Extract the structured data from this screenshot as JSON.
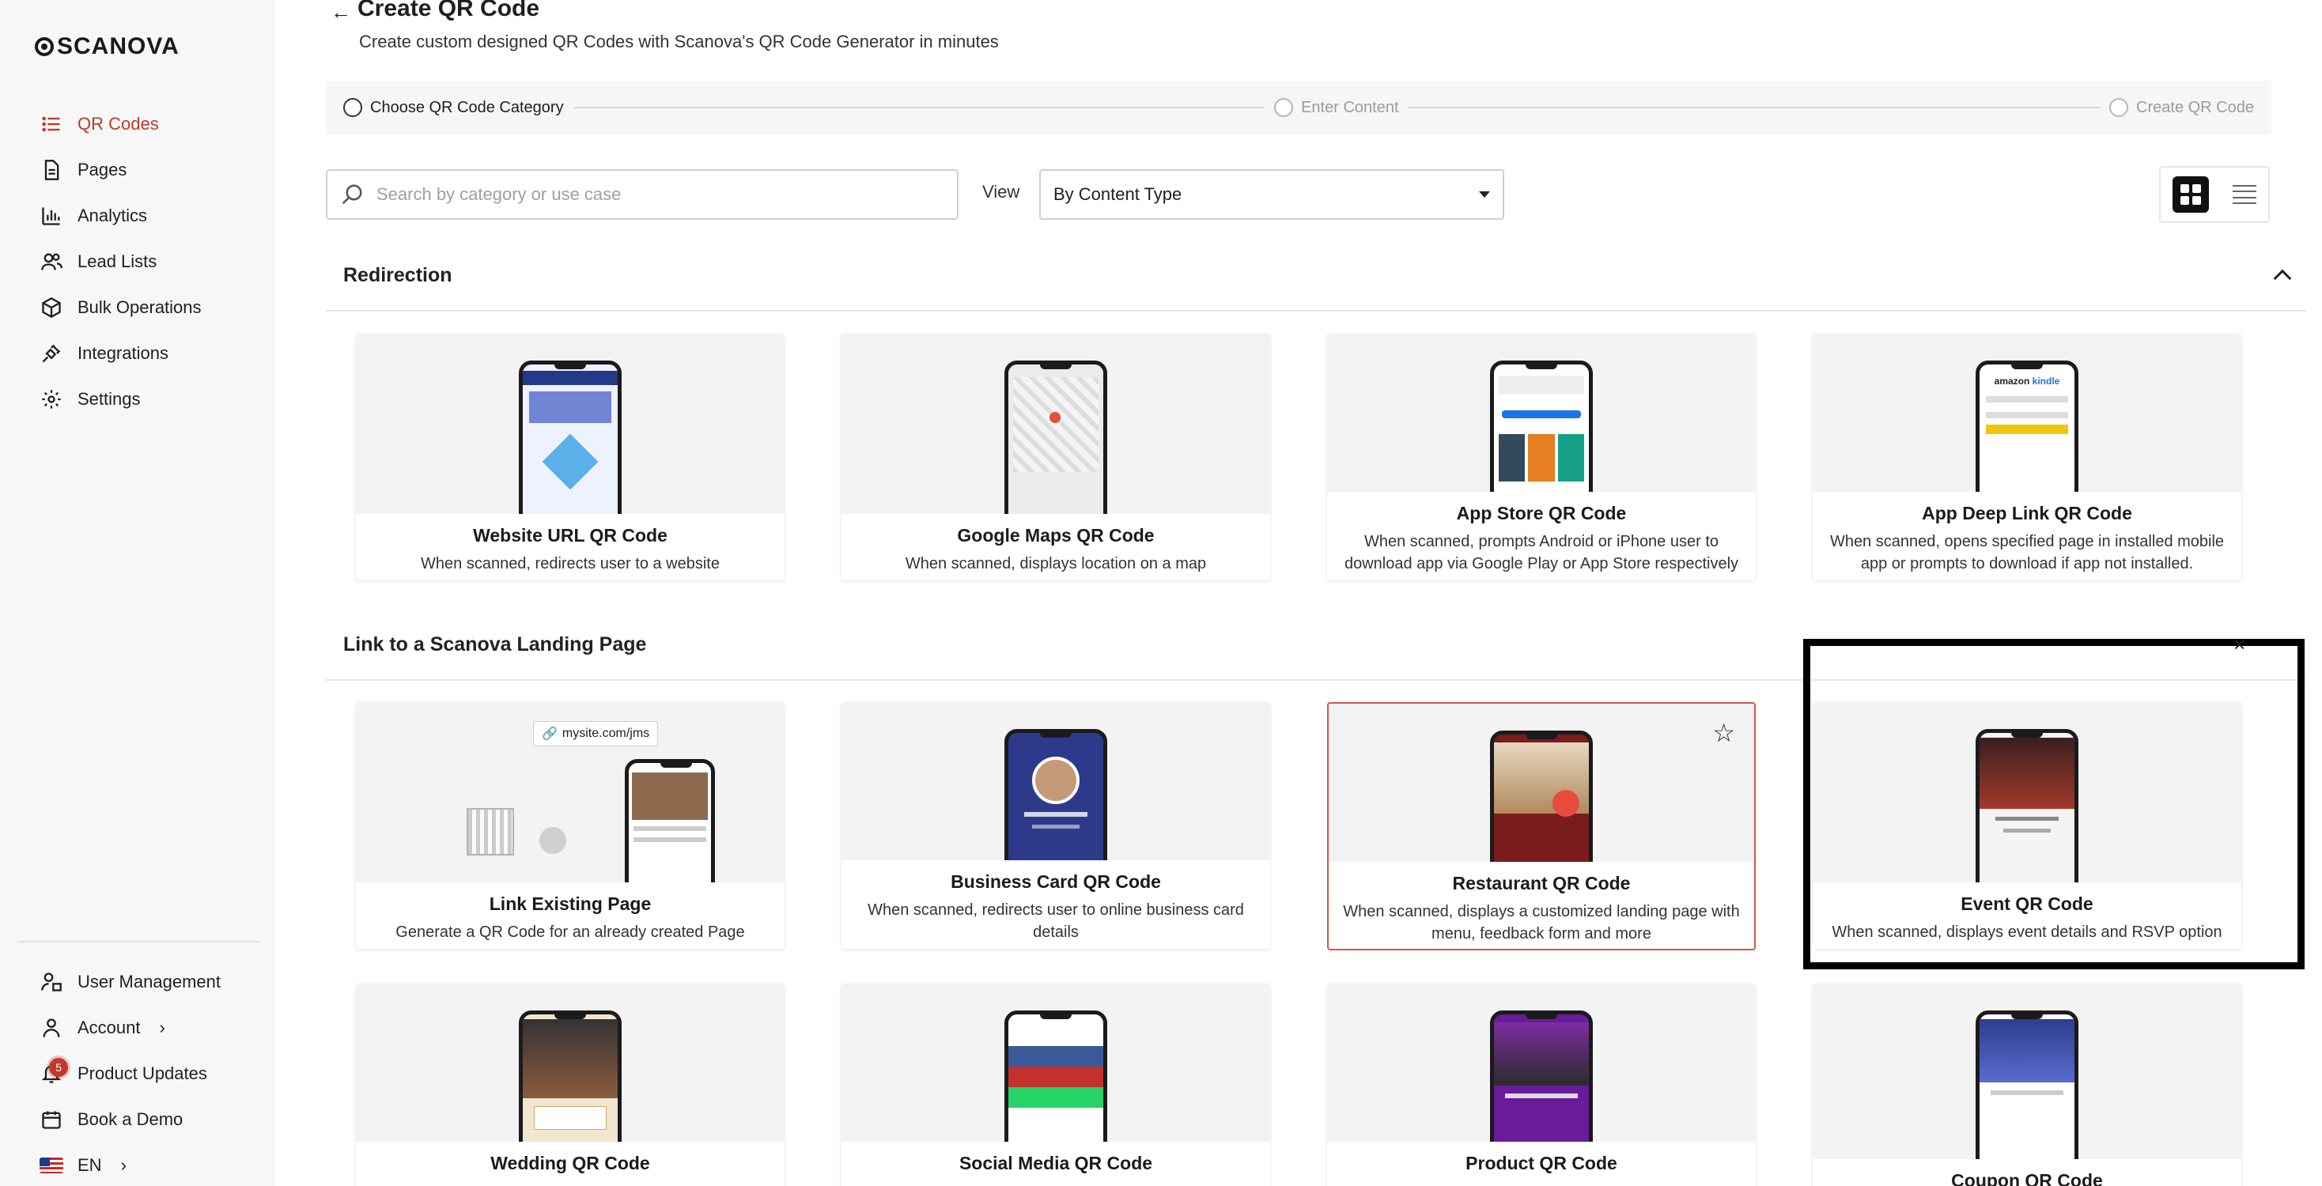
{
  "brand": {
    "name": "SCANOVA",
    "accent": "#c0392b"
  },
  "sidebar": {
    "items": [
      {
        "label": "QR Codes",
        "icon": "list-icon",
        "active": true
      },
      {
        "label": "Pages",
        "icon": "page-icon"
      },
      {
        "label": "Analytics",
        "icon": "bar-chart-icon"
      },
      {
        "label": "Lead Lists",
        "icon": "people-icon"
      },
      {
        "label": "Bulk Operations",
        "icon": "box-icon"
      },
      {
        "label": "Integrations",
        "icon": "plug-icon"
      },
      {
        "label": "Settings",
        "icon": "gear-icon"
      }
    ],
    "bottom": [
      {
        "label": "User Management",
        "icon": "user-manage-icon"
      },
      {
        "label": "Account",
        "icon": "user-icon"
      },
      {
        "label": "Product Updates",
        "icon": "bell-icon",
        "badge": "5"
      },
      {
        "label": "Book a Demo",
        "icon": "calendar-icon"
      },
      {
        "label": "EN",
        "icon": "us-flag-icon"
      }
    ]
  },
  "header": {
    "title": "Create QR Code",
    "subtitle": "Create custom designed QR Codes with Scanova's QR Code Generator in minutes"
  },
  "stepper": {
    "steps": [
      "Choose QR Code Category",
      "Enter Content",
      "Create QR Code"
    ]
  },
  "filters": {
    "search_placeholder": "Search by category or use case",
    "view_label": "View",
    "view_value": "By Content Type"
  },
  "sections": [
    {
      "title": "Redirection",
      "cards": [
        {
          "title": "Website URL QR Code",
          "desc": "When scanned, redirects user to a website"
        },
        {
          "title": "Google Maps QR Code",
          "desc": "When scanned, displays location on a map"
        },
        {
          "title": "App Store QR Code",
          "desc": "When scanned, prompts Android or iPhone user to download app via Google Play or App Store respectively"
        },
        {
          "title": "App Deep Link QR Code",
          "desc": "When scanned, opens specified page in installed mobile app or prompts to download if app not installed."
        }
      ]
    },
    {
      "title": "Link to a Scanova Landing Page",
      "cards": [
        {
          "title": "Link Existing Page",
          "desc": "Generate a QR Code for an already created Page",
          "chip": "mysite.com/jms"
        },
        {
          "title": "Business Card QR Code",
          "desc": "When scanned, redirects user to online business card details"
        },
        {
          "title": "Restaurant QR Code",
          "desc": "When scanned, displays a customized landing page with menu, feedback form and more"
        },
        {
          "title": "Event QR Code",
          "desc": "When scanned, displays event details and RSVP option"
        }
      ],
      "more_cards": [
        {
          "title": "Wedding QR Code"
        },
        {
          "title": "Social Media QR Code"
        },
        {
          "title": "Product QR Code"
        },
        {
          "title": "Coupon QR Code"
        }
      ]
    }
  ]
}
